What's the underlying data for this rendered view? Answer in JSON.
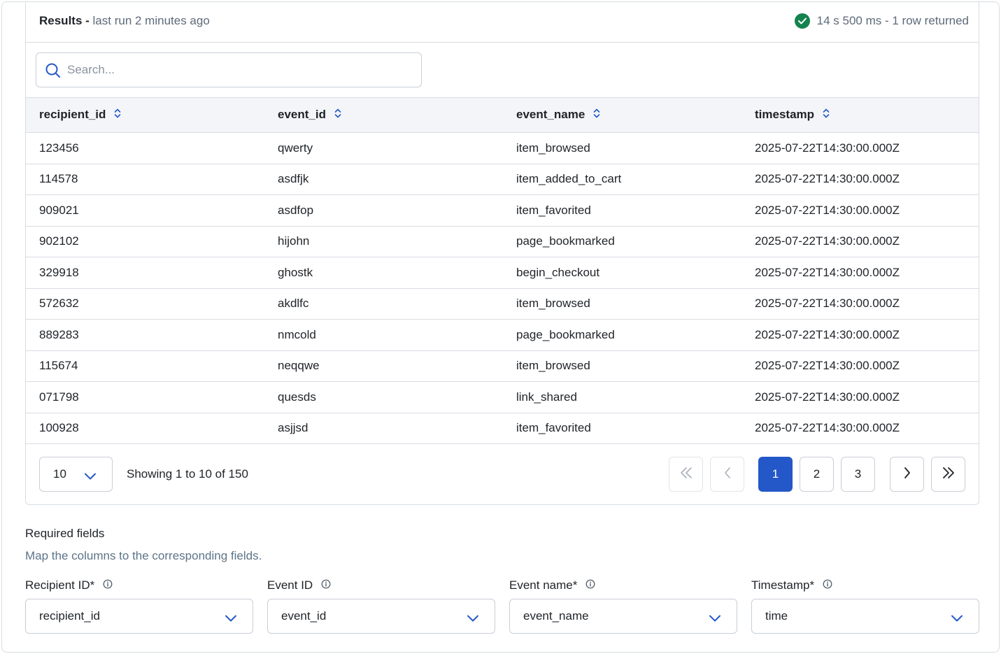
{
  "results_header": {
    "title": "Results",
    "separator": " - ",
    "last_run": "last run 2 minutes ago",
    "status": "14 s 500 ms - 1 row returned"
  },
  "search": {
    "placeholder": "Search..."
  },
  "table": {
    "columns": [
      "recipient_id",
      "event_id",
      "event_name",
      "timestamp"
    ],
    "rows": [
      [
        "123456",
        "qwerty",
        "item_browsed",
        "2025-07-22T14:30:00.000Z"
      ],
      [
        "114578",
        "asdfjk",
        "item_added_to_cart",
        "2025-07-22T14:30:00.000Z"
      ],
      [
        "909021",
        "asdfop",
        "item_favorited",
        "2025-07-22T14:30:00.000Z"
      ],
      [
        "902102",
        "hijohn",
        "page_bookmarked",
        "2025-07-22T14:30:00.000Z"
      ],
      [
        "329918",
        "ghostk",
        "begin_checkout",
        "2025-07-22T14:30:00.000Z"
      ],
      [
        "572632",
        "akdlfc",
        "item_browsed",
        "2025-07-22T14:30:00.000Z"
      ],
      [
        "889283",
        "nmcold",
        "page_bookmarked",
        "2025-07-22T14:30:00.000Z"
      ],
      [
        "115674",
        "neqqwe",
        "item_browsed",
        "2025-07-22T14:30:00.000Z"
      ],
      [
        "071798",
        "quesds",
        "link_shared",
        "2025-07-22T14:30:00.000Z"
      ],
      [
        "100928",
        "asjjsd",
        "item_favorited",
        "2025-07-22T14:30:00.000Z"
      ]
    ]
  },
  "pagination": {
    "page_size": "10",
    "showing": "Showing 1 to 10 of 150",
    "pages": [
      "1",
      "2",
      "3"
    ],
    "active_page": "1"
  },
  "required_fields": {
    "title": "Required fields",
    "subtitle": "Map the columns to the corresponding fields.",
    "fields": [
      {
        "label": "Recipient ID",
        "required_mark": " *",
        "value": "recipient_id"
      },
      {
        "label": "Event ID",
        "required_mark": "",
        "value": "event_id"
      },
      {
        "label": "Event name",
        "required_mark": " *",
        "value": "event_name"
      },
      {
        "label": "Timestamp",
        "required_mark": " *",
        "value": "time"
      }
    ]
  },
  "colors": {
    "accent": "#2458c8",
    "success": "#14834e",
    "border": "#d8dce2",
    "header_bg": "#f3f5f8",
    "muted_text": "#5d6b7a"
  },
  "icons": {
    "status": "check-circle-icon",
    "search": "search-icon",
    "sort": "sort-icon",
    "dropdown": "chevron-down-icon",
    "first": "double-chevron-left-icon",
    "prev": "chevron-left-icon",
    "next": "chevron-right-icon",
    "last": "double-chevron-right-icon",
    "info": "info-icon"
  }
}
